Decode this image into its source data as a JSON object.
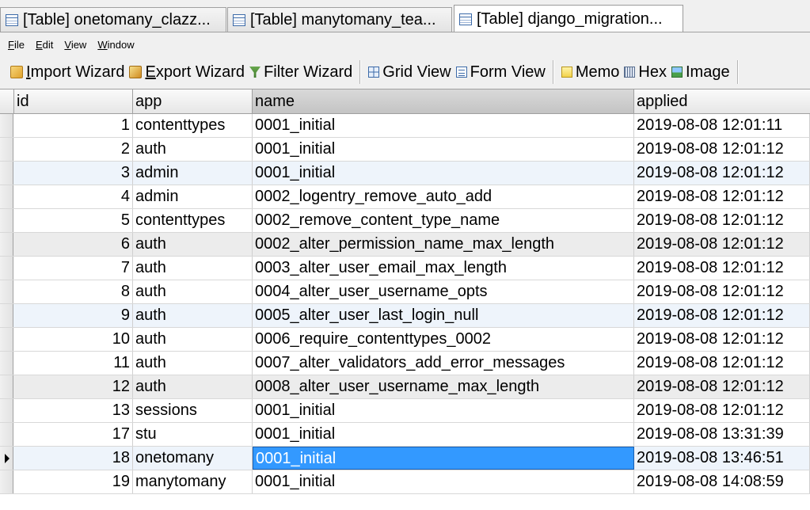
{
  "tabs": [
    {
      "label": "[Table] onetomany_clazz...",
      "active": false
    },
    {
      "label": "[Table] manytomany_tea...",
      "active": false
    },
    {
      "label": "[Table] django_migration...",
      "active": true
    }
  ],
  "menu": {
    "file": {
      "u": "F",
      "rest": "ile"
    },
    "edit": {
      "u": "E",
      "rest": "dit"
    },
    "view": {
      "u": "V",
      "rest": "iew"
    },
    "window": {
      "u": "W",
      "rest": "indow"
    }
  },
  "toolbar": {
    "import": {
      "u": "I",
      "rest": "mport Wizard",
      "icon": "import-wizard-icon"
    },
    "export": {
      "u": "E",
      "rest": "xport Wizard",
      "icon": "export-wizard-icon"
    },
    "filter": {
      "label": "Filter Wizard",
      "icon": "filter-wizard-icon"
    },
    "grid": {
      "label": "Grid View",
      "icon": "grid-view-icon"
    },
    "form": {
      "label": "Form View",
      "icon": "form-view-icon"
    },
    "memo": {
      "label": "Memo",
      "icon": "memo-icon"
    },
    "hex": {
      "label": "Hex",
      "icon": "hex-icon"
    },
    "image": {
      "label": "Image",
      "icon": "image-icon"
    }
  },
  "grid": {
    "columns": [
      "id",
      "app",
      "name",
      "applied"
    ],
    "sorted_column": "name",
    "rows": [
      {
        "id": "1",
        "app": "contenttypes",
        "name": "0001_initial",
        "applied": "2019-08-08 12:01:11"
      },
      {
        "id": "2",
        "app": "auth",
        "name": "0001_initial",
        "applied": "2019-08-08 12:01:12"
      },
      {
        "id": "3",
        "app": "admin",
        "name": "0001_initial",
        "applied": "2019-08-08 12:01:12"
      },
      {
        "id": "4",
        "app": "admin",
        "name": "0002_logentry_remove_auto_add",
        "applied": "2019-08-08 12:01:12"
      },
      {
        "id": "5",
        "app": "contenttypes",
        "name": "0002_remove_content_type_name",
        "applied": "2019-08-08 12:01:12"
      },
      {
        "id": "6",
        "app": "auth",
        "name": "0002_alter_permission_name_max_length",
        "applied": "2019-08-08 12:01:12"
      },
      {
        "id": "7",
        "app": "auth",
        "name": "0003_alter_user_email_max_length",
        "applied": "2019-08-08 12:01:12"
      },
      {
        "id": "8",
        "app": "auth",
        "name": "0004_alter_user_username_opts",
        "applied": "2019-08-08 12:01:12"
      },
      {
        "id": "9",
        "app": "auth",
        "name": "0005_alter_user_last_login_null",
        "applied": "2019-08-08 12:01:12"
      },
      {
        "id": "10",
        "app": "auth",
        "name": "0006_require_contenttypes_0002",
        "applied": "2019-08-08 12:01:12"
      },
      {
        "id": "11",
        "app": "auth",
        "name": "0007_alter_validators_add_error_messages",
        "applied": "2019-08-08 12:01:12"
      },
      {
        "id": "12",
        "app": "auth",
        "name": "0008_alter_user_username_max_length",
        "applied": "2019-08-08 12:01:12"
      },
      {
        "id": "13",
        "app": "sessions",
        "name": "0001_initial",
        "applied": "2019-08-08 12:01:12"
      },
      {
        "id": "17",
        "app": "stu",
        "name": "0001_initial",
        "applied": "2019-08-08 13:31:39"
      },
      {
        "id": "18",
        "app": "onetomany",
        "name": "0001_initial",
        "applied": "2019-08-08 13:46:51"
      },
      {
        "id": "19",
        "app": "manytomany",
        "name": "0001_initial",
        "applied": "2019-08-08 14:08:59"
      }
    ],
    "selected_row": 14,
    "selected_column": "name"
  },
  "colors": {
    "selection": "#3399ff",
    "row_blue": "#eef4fb",
    "row_grey": "#ececec"
  }
}
